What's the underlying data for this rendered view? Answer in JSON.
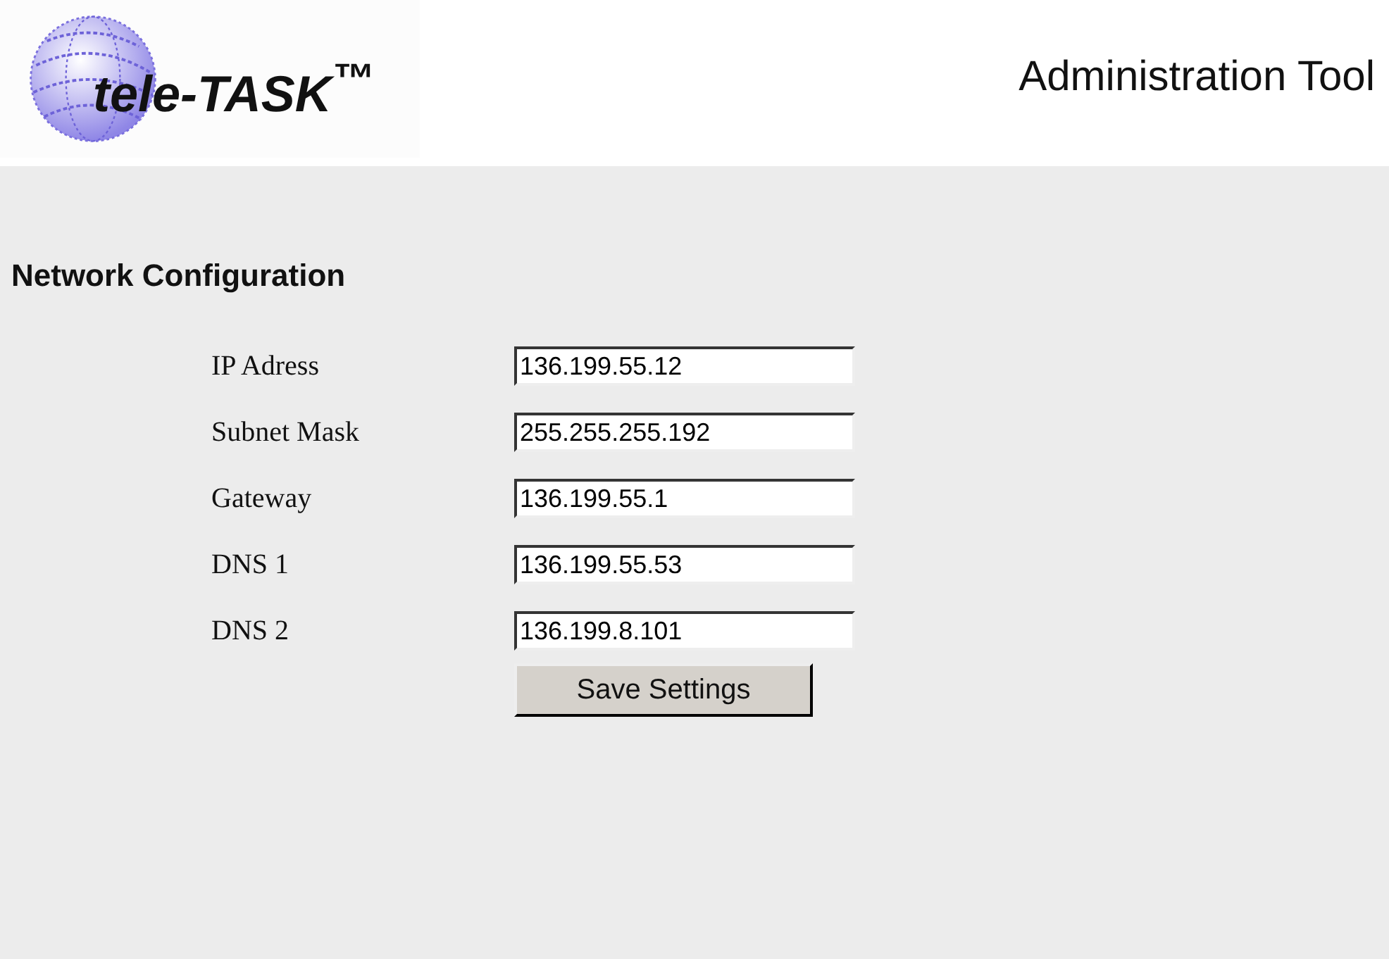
{
  "header": {
    "logo_text": "tele-TASK$^{™}$",
    "title": "Administration Tool"
  },
  "section": {
    "heading": "Network Configuration",
    "fields": [
      {
        "label": "IP Adress",
        "value": "136.199.55.12"
      },
      {
        "label": "Subnet Mask",
        "value": "255.255.255.192"
      },
      {
        "label": "Gateway",
        "value": "136.199.55.1"
      },
      {
        "label": "DNS 1",
        "value": "136.199.55.53"
      },
      {
        "label": "DNS 2",
        "value": "136.199.8.101"
      }
    ],
    "button": "Save Settings"
  }
}
